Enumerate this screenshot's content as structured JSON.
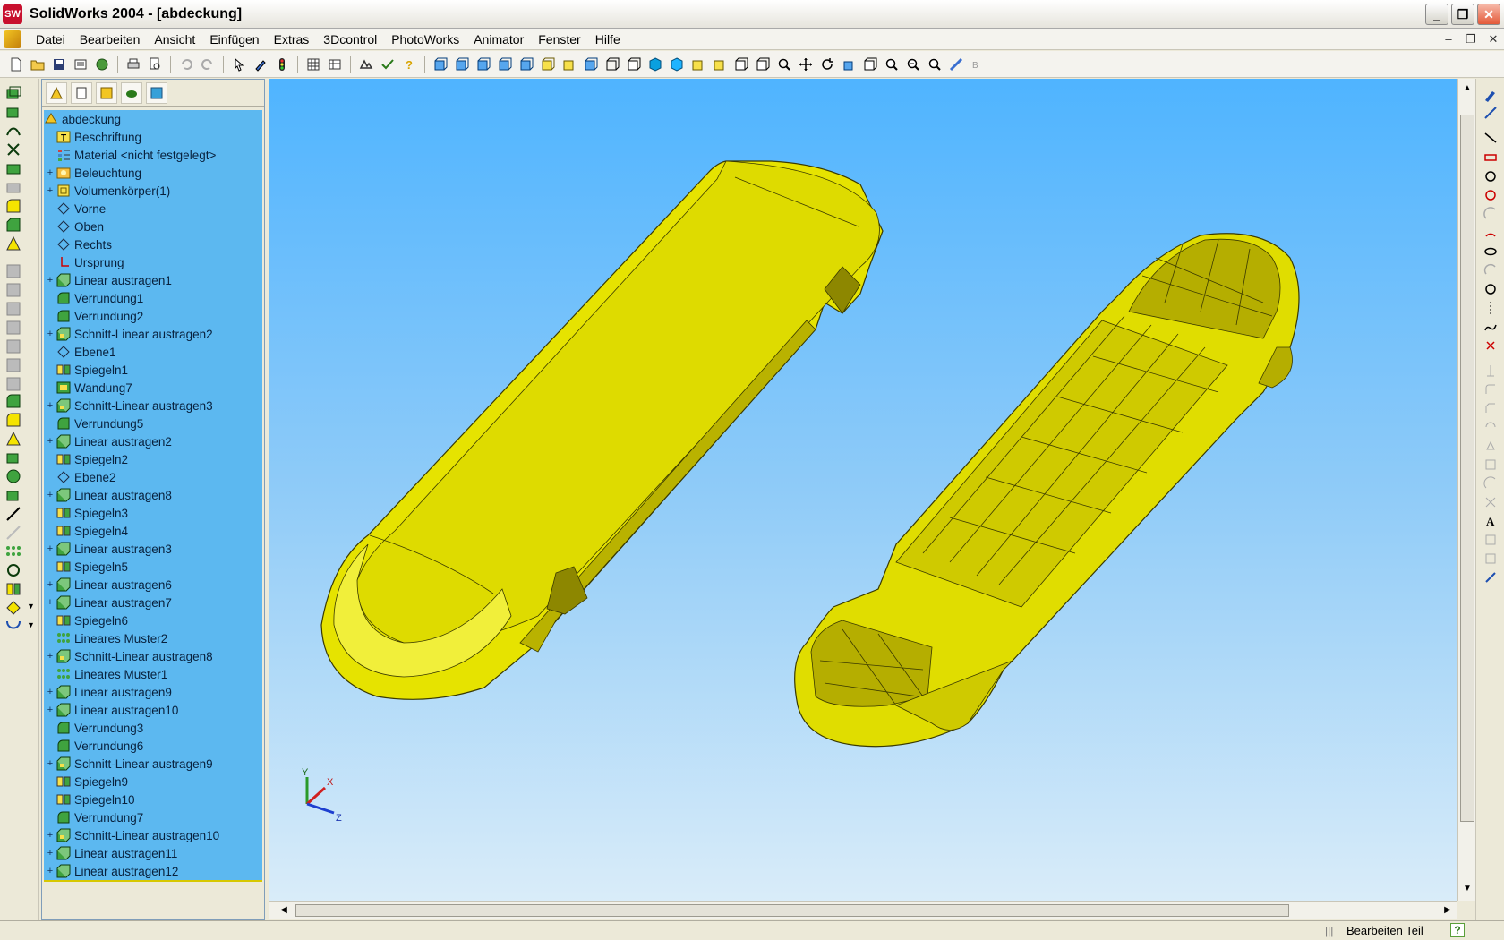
{
  "window": {
    "title": "SolidWorks 2004 - [abdeckung]",
    "app_icon_label": "SW",
    "controls": {
      "minimize": "_",
      "maximize": "❐",
      "close": "✕"
    },
    "mdi_controls": {
      "minimize": "–",
      "restore": "❐",
      "close": "✕"
    }
  },
  "menu": {
    "items": [
      "Datei",
      "Bearbeiten",
      "Ansicht",
      "Einfügen",
      "Extras",
      "3Dcontrol",
      "PhotoWorks",
      "Animator",
      "Fenster",
      "Hilfe"
    ]
  },
  "toolbar": {
    "buttons": [
      "new-document-icon",
      "open-icon",
      "save-icon",
      "print-preview-icon",
      "print-icon",
      "undo-icon",
      "redo-icon",
      "select-icon",
      "sketch-icon",
      "rebuild-icon",
      "options-icon",
      "help-icon",
      "view-orientation-icon",
      "zoom-fit-icon",
      "zoom-area-icon",
      "pan-icon",
      "rotate-icon"
    ]
  },
  "feature_tree": {
    "root": "abdeckung",
    "items": [
      {
        "label": "Beschriftung",
        "icon": "annotation-icon",
        "expandable": false
      },
      {
        "label": "Material <nicht festgelegt>",
        "icon": "material-icon",
        "expandable": false
      },
      {
        "label": "Beleuchtung",
        "icon": "lighting-icon",
        "expandable": true
      },
      {
        "label": "Volumenkörper(1)",
        "icon": "solid-body-icon",
        "expandable": true
      },
      {
        "label": "Vorne",
        "icon": "plane-icon",
        "expandable": false
      },
      {
        "label": "Oben",
        "icon": "plane-icon",
        "expandable": false
      },
      {
        "label": "Rechts",
        "icon": "plane-icon",
        "expandable": false
      },
      {
        "label": "Ursprung",
        "icon": "origin-icon",
        "expandable": false
      },
      {
        "label": "Linear austragen1",
        "icon": "extrude-icon",
        "expandable": true
      },
      {
        "label": "Verrundung1",
        "icon": "fillet-icon",
        "expandable": false
      },
      {
        "label": "Verrundung2",
        "icon": "fillet-icon",
        "expandable": false
      },
      {
        "label": "Schnitt-Linear austragen2",
        "icon": "cut-extrude-icon",
        "expandable": true
      },
      {
        "label": "Ebene1",
        "icon": "plane-icon",
        "expandable": false
      },
      {
        "label": "Spiegeln1",
        "icon": "mirror-icon",
        "expandable": false
      },
      {
        "label": "Wandung7",
        "icon": "shell-icon",
        "expandable": false
      },
      {
        "label": "Schnitt-Linear austragen3",
        "icon": "cut-extrude-icon",
        "expandable": true
      },
      {
        "label": "Verrundung5",
        "icon": "fillet-icon",
        "expandable": false
      },
      {
        "label": "Linear austragen2",
        "icon": "extrude-icon",
        "expandable": true
      },
      {
        "label": "Spiegeln2",
        "icon": "mirror-icon",
        "expandable": false
      },
      {
        "label": "Ebene2",
        "icon": "plane-icon",
        "expandable": false
      },
      {
        "label": "Linear austragen8",
        "icon": "extrude-icon",
        "expandable": true
      },
      {
        "label": "Spiegeln3",
        "icon": "mirror-icon",
        "expandable": false
      },
      {
        "label": "Spiegeln4",
        "icon": "mirror-icon",
        "expandable": false
      },
      {
        "label": "Linear austragen3",
        "icon": "extrude-icon",
        "expandable": true
      },
      {
        "label": "Spiegeln5",
        "icon": "mirror-icon",
        "expandable": false
      },
      {
        "label": "Linear austragen6",
        "icon": "extrude-icon",
        "expandable": true
      },
      {
        "label": "Linear austragen7",
        "icon": "extrude-icon",
        "expandable": true
      },
      {
        "label": "Spiegeln6",
        "icon": "mirror-icon",
        "expandable": false
      },
      {
        "label": "Lineares Muster2",
        "icon": "pattern-icon",
        "expandable": false
      },
      {
        "label": "Schnitt-Linear austragen8",
        "icon": "cut-extrude-icon",
        "expandable": true
      },
      {
        "label": "Lineares Muster1",
        "icon": "pattern-icon",
        "expandable": false
      },
      {
        "label": "Linear austragen9",
        "icon": "extrude-icon",
        "expandable": true
      },
      {
        "label": "Linear austragen10",
        "icon": "extrude-icon",
        "expandable": true
      },
      {
        "label": "Verrundung3",
        "icon": "fillet-icon",
        "expandable": false
      },
      {
        "label": "Verrundung6",
        "icon": "fillet-icon",
        "expandable": false
      },
      {
        "label": "Schnitt-Linear austragen9",
        "icon": "cut-extrude-icon",
        "expandable": true
      },
      {
        "label": "Spiegeln9",
        "icon": "mirror-icon",
        "expandable": false
      },
      {
        "label": "Spiegeln10",
        "icon": "mirror-icon",
        "expandable": false
      },
      {
        "label": "Verrundung7",
        "icon": "fillet-icon",
        "expandable": false
      },
      {
        "label": "Schnitt-Linear austragen10",
        "icon": "cut-extrude-icon",
        "expandable": true
      },
      {
        "label": "Linear austragen11",
        "icon": "extrude-icon",
        "expandable": true
      },
      {
        "label": "Linear austragen12",
        "icon": "extrude-icon",
        "expandable": true
      }
    ]
  },
  "viewport": {
    "triad": {
      "x": "X",
      "y": "Y",
      "z": "Z"
    },
    "colors": {
      "part": "#e3e000",
      "part_shadow": "#b9b200",
      "edge": "#3a3a00",
      "sky_top": "#4fb4ff",
      "sky_bottom": "#d9ecf9"
    }
  },
  "statusbar": {
    "mode": "Bearbeiten Teil",
    "help": "?"
  }
}
